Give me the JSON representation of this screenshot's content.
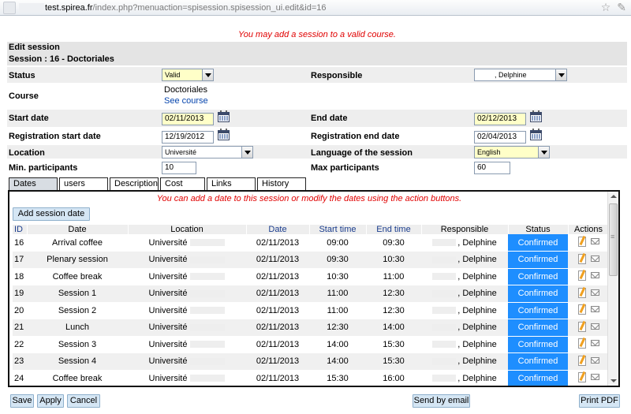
{
  "browser": {
    "url_host": "test.spirea.fr",
    "url_path": "/index.php?menuaction=spisession.spisession_ui.edit&id=16"
  },
  "flash_message": "You may add a session to a valid course.",
  "header": {
    "edit_title": "Edit session",
    "session_title": "Session : 16 - Doctoriales"
  },
  "form": {
    "status_label": "Status",
    "status_value": "Valid",
    "responsible_label": "Responsible",
    "responsible_value": ", Delphine",
    "course_label": "Course",
    "course_value": "Doctoriales",
    "course_link": "See course",
    "start_date_label": "Start date",
    "start_date_value": "02/11/2013",
    "end_date_label": "End date",
    "end_date_value": "02/12/2013",
    "reg_start_label": "Registration start date",
    "reg_start_value": "12/19/2012",
    "reg_end_label": "Registration end date",
    "reg_end_value": "02/04/2013",
    "location_label": "Location",
    "location_value": "Université",
    "language_label": "Language of the session",
    "language_value": "English",
    "min_label": "Min. participants",
    "min_value": "10",
    "max_label": "Max participants",
    "max_value": "60"
  },
  "tabs": [
    "Dates",
    "users",
    "Description",
    "Cost",
    "Links",
    "History"
  ],
  "dates_panel": {
    "message": "You can add a date to this session or modify the dates using the action buttons.",
    "add_button": "Add session date",
    "columns": [
      "ID",
      "Date",
      "Location",
      "Date",
      "Start time",
      "End time",
      "Responsible",
      "Status",
      "Actions"
    ],
    "rows": [
      {
        "id": "16",
        "name": "Arrival coffee",
        "location": "Université",
        "date": "02/11/2013",
        "start": "09:00",
        "end": "09:30",
        "responsible": ", Delphine",
        "status": "Confirmed"
      },
      {
        "id": "17",
        "name": "Plenary session",
        "location": "Université",
        "date": "02/11/2013",
        "start": "09:30",
        "end": "10:30",
        "responsible": ", Delphine",
        "status": "Confirmed"
      },
      {
        "id": "18",
        "name": "Coffee break",
        "location": "Université",
        "date": "02/11/2013",
        "start": "10:30",
        "end": "11:00",
        "responsible": ", Delphine",
        "status": "Confirmed"
      },
      {
        "id": "19",
        "name": "Session 1",
        "location": "Université",
        "date": "02/11/2013",
        "start": "11:00",
        "end": "12:30",
        "responsible": ", Delphine",
        "status": "Confirmed"
      },
      {
        "id": "20",
        "name": "Session 2",
        "location": "Université",
        "date": "02/11/2013",
        "start": "11:00",
        "end": "12:30",
        "responsible": ", Delphine",
        "status": "Confirmed"
      },
      {
        "id": "21",
        "name": "Lunch",
        "location": "Université",
        "date": "02/11/2013",
        "start": "12:30",
        "end": "14:00",
        "responsible": ", Delphine",
        "status": "Confirmed"
      },
      {
        "id": "22",
        "name": "Session 3",
        "location": "Université",
        "date": "02/11/2013",
        "start": "14:00",
        "end": "15:30",
        "responsible": ", Delphine",
        "status": "Confirmed"
      },
      {
        "id": "23",
        "name": "Session 4",
        "location": "Université",
        "date": "02/11/2013",
        "start": "14:00",
        "end": "15:30",
        "responsible": ", Delphine",
        "status": "Confirmed"
      },
      {
        "id": "24",
        "name": "Coffee break",
        "location": "Université",
        "date": "02/11/2013",
        "start": "15:30",
        "end": "16:00",
        "responsible": ", Delphine",
        "status": "Confirmed"
      }
    ]
  },
  "footer": {
    "save": "Save",
    "apply": "Apply",
    "cancel": "Cancel",
    "send_email": "Send by email",
    "print_pdf": "Print PDF"
  },
  "colors": {
    "status_confirmed": "#1e8eff",
    "flash_text": "#e00000",
    "section_bg": "#e4e4e4",
    "required_field_bg": "#ffffc8"
  }
}
